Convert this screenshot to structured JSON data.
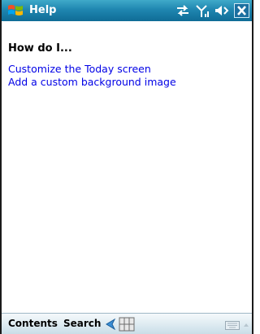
{
  "titlebar": {
    "title": "Help",
    "icons": [
      "windows-start-icon",
      "connectivity-icon",
      "signal-icon",
      "volume-icon",
      "close-icon"
    ],
    "close_label": "X"
  },
  "main": {
    "heading": "How do I...",
    "links": [
      "Customize the Today screen",
      "Add a custom background image"
    ]
  },
  "menubar": {
    "left_softkey": "Contents",
    "right_softkey": "Search",
    "icons": [
      "back-icon",
      "grid-icon",
      "keyboard-icon",
      "input-arrow-icon"
    ]
  },
  "colors": {
    "titlebar": "#1f86b0",
    "link": "#0000e6",
    "menubar": "#dbe9f0"
  }
}
